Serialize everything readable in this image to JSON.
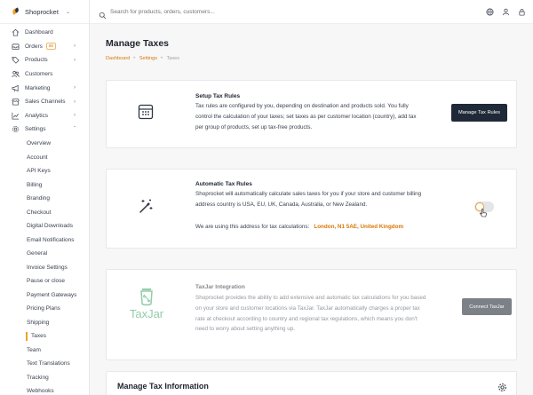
{
  "brand": {
    "name": "Shoprocket"
  },
  "search": {
    "placeholder": "Search for products, orders, customers..."
  },
  "nav": {
    "dashboard": "Dashboard",
    "orders": "Orders",
    "orders_badge": "88",
    "products": "Products",
    "customers": "Customers",
    "marketing": "Marketing",
    "sales_channels": "Sales Channels",
    "analytics": "Analytics",
    "settings": "Settings"
  },
  "settings_items": [
    "Overview",
    "Account",
    "API Keys",
    "Billing",
    "Branding",
    "Checkout",
    "Digital Downloads",
    "Email Notifications",
    "General",
    "Invoice Settings",
    "Pause or close",
    "Payment Gateways",
    "Pricing Plans",
    "Shipping",
    "Taxes",
    "Team",
    "Text Translations",
    "Tracking",
    "Webhooks"
  ],
  "page": {
    "title": "Manage Taxes",
    "breadcrumb": [
      "Dashboard",
      "Settings",
      "Taxes"
    ]
  },
  "setup": {
    "title": "Setup Tax Rules",
    "lines": [
      "Tax rules are configured by you, depending on destination and products sold. You fully",
      "control the calculation of your taxes; set taxes as per customer location (country), add tax",
      "per group of products, set up tax-free products."
    ],
    "button": "Manage Tax Rules"
  },
  "automatic": {
    "title": "Automatic Tax Rules",
    "lines": [
      "Shoprocket will automatically calculate sales taxes for you if your store and customer billing",
      "address country is USA, EU, UK, Canada, Australia, or New Zealand."
    ],
    "address_label": "We are using this address for tax calculations:",
    "address_value": "London, N1 5AE, United Kingdom",
    "toggle_on": false
  },
  "taxjar": {
    "title": "TaxJar Integration",
    "lines": [
      "Shoprocket provides the ability to add extensive and automatic tax calculations for you based",
      "on your store and customer locations via TaxJar. TaxJar automatically charges a proper tax",
      "rate at checkout according to country and regional tax regulations, which means you don't",
      "need to worry about setting anything up."
    ],
    "button": "Connect TaxJar",
    "logo_text": "TaxJar"
  },
  "manage": {
    "title": "Manage Tax Information"
  },
  "colors": {
    "accent": "#f0a02b",
    "accent_text": "#d97706",
    "dark_button": "#1f2937",
    "taxjar_green": "#3aa363"
  }
}
